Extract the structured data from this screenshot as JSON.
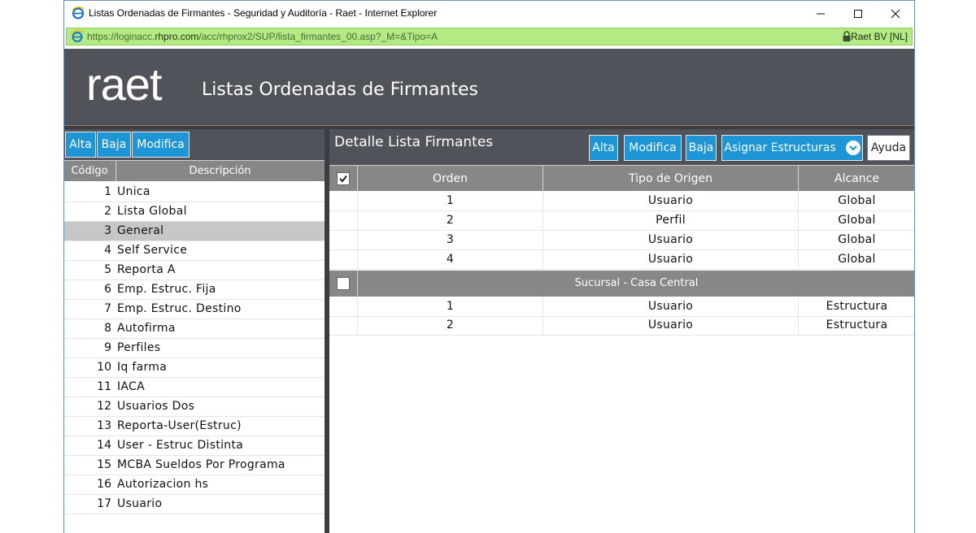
{
  "window": {
    "title": "Listas Ordenadas de Firmantes - Seguridad y Auditoría - Raet - Internet Explorer",
    "url_prefix": "https://loginacc.",
    "url_domain": "rhpro.com",
    "url_path": "/acc/rhprox2/SUP/lista_firmantes_00.asp?_M=&Tipo=A",
    "certificate": "Raet BV [NL]"
  },
  "header": {
    "logo": "raet",
    "title": "Listas Ordenadas de Firmantes"
  },
  "left_toolbar": {
    "alta": "Alta",
    "baja": "Baja",
    "modifica": "Modifica"
  },
  "list": {
    "columns": {
      "code": "Código",
      "description": "Descripción"
    },
    "selected_index": 2,
    "rows": [
      {
        "code": "1",
        "desc": "Unica"
      },
      {
        "code": "2",
        "desc": "Lista Global"
      },
      {
        "code": "3",
        "desc": "General"
      },
      {
        "code": "4",
        "desc": "Self Service"
      },
      {
        "code": "5",
        "desc": "Reporta A"
      },
      {
        "code": "6",
        "desc": "Emp. Estruc. Fija"
      },
      {
        "code": "7",
        "desc": "Emp. Estruc. Destino"
      },
      {
        "code": "8",
        "desc": "Autofirma"
      },
      {
        "code": "9",
        "desc": "Perfiles"
      },
      {
        "code": "10",
        "desc": "Iq farma"
      },
      {
        "code": "11",
        "desc": "IACA"
      },
      {
        "code": "12",
        "desc": "Usuarios Dos"
      },
      {
        "code": "13",
        "desc": "Reporta-User(Estruc)"
      },
      {
        "code": "14",
        "desc": "User - Estruc Distinta"
      },
      {
        "code": "15",
        "desc": "MCBA Sueldos Por Programa"
      },
      {
        "code": "16",
        "desc": "Autorizacion hs"
      },
      {
        "code": "17",
        "desc": "Usuario"
      }
    ]
  },
  "detail": {
    "title": "Detalle Lista Firmantes",
    "buttons": {
      "alta": "Alta",
      "modifica": "Modifica",
      "baja": "Baja",
      "asignar": "Asignar Estructuras",
      "ayuda": "Ayuda"
    },
    "columns": {
      "orden": "Orden",
      "tipo": "Tipo de Origen",
      "alcance": "Alcance"
    },
    "header_checked": true,
    "rows": [
      {
        "orden": "1",
        "tipo": "Usuario",
        "alcance": "Global"
      },
      {
        "orden": "2",
        "tipo": "Perfil",
        "alcance": "Global"
      },
      {
        "orden": "3",
        "tipo": "Usuario",
        "alcance": "Global"
      },
      {
        "orden": "4",
        "tipo": "Usuario",
        "alcance": "Global"
      }
    ],
    "group": {
      "label": "Sucursal - Casa Central",
      "checked": false,
      "rows": [
        {
          "orden": "1",
          "tipo": "Usuario",
          "alcance": "Estructura"
        },
        {
          "orden": "2",
          "tipo": "Usuario",
          "alcance": "Estructura"
        }
      ]
    }
  }
}
